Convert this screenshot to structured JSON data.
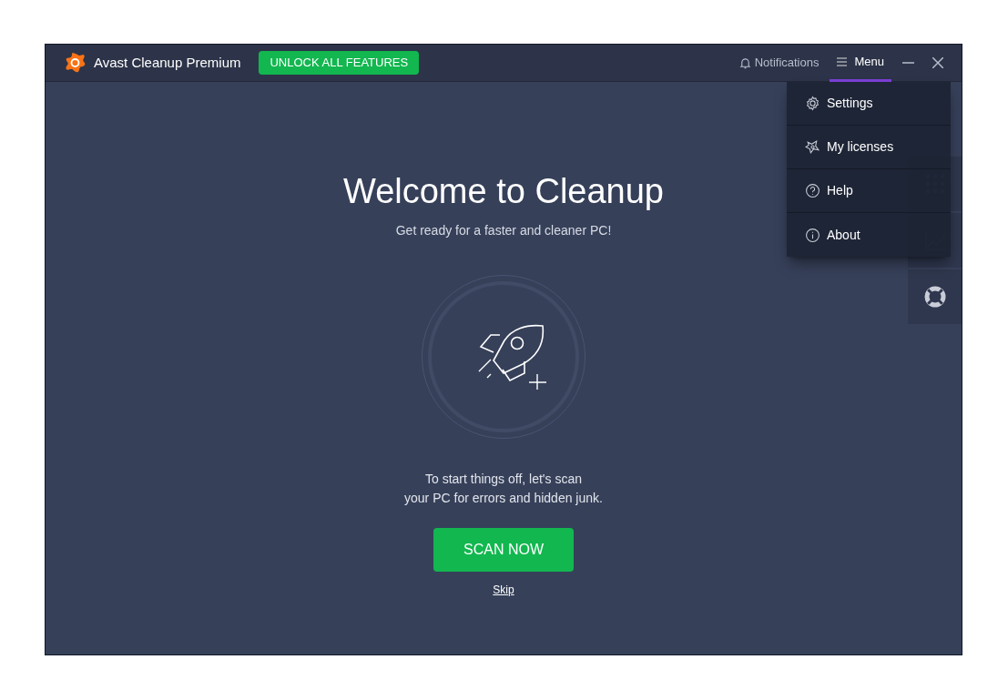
{
  "window": {
    "title": "Avast Cleanup Premium",
    "unlock_button": "UNLOCK ALL FEATURES",
    "notifications": "Notifications",
    "menu": {
      "label": "Menu",
      "open": true
    }
  },
  "menu_items": [
    {
      "kind": "settings",
      "label": "Settings"
    },
    {
      "kind": "licenses",
      "label": "My licenses"
    },
    {
      "kind": "help",
      "label": "Help"
    },
    {
      "kind": "about",
      "label": "About"
    }
  ],
  "side_tiles": [
    {
      "kind": "grid"
    },
    {
      "kind": "chart"
    },
    {
      "kind": "support"
    }
  ],
  "welcome": {
    "title": "Welcome to Cleanup",
    "subtitle": "Get ready for a faster and cleaner PC!",
    "intro": [
      "To start things off, let's scan",
      "your PC for errors and hidden junk."
    ],
    "scan_button": "SCAN NOW",
    "skip_link": "Skip"
  }
}
